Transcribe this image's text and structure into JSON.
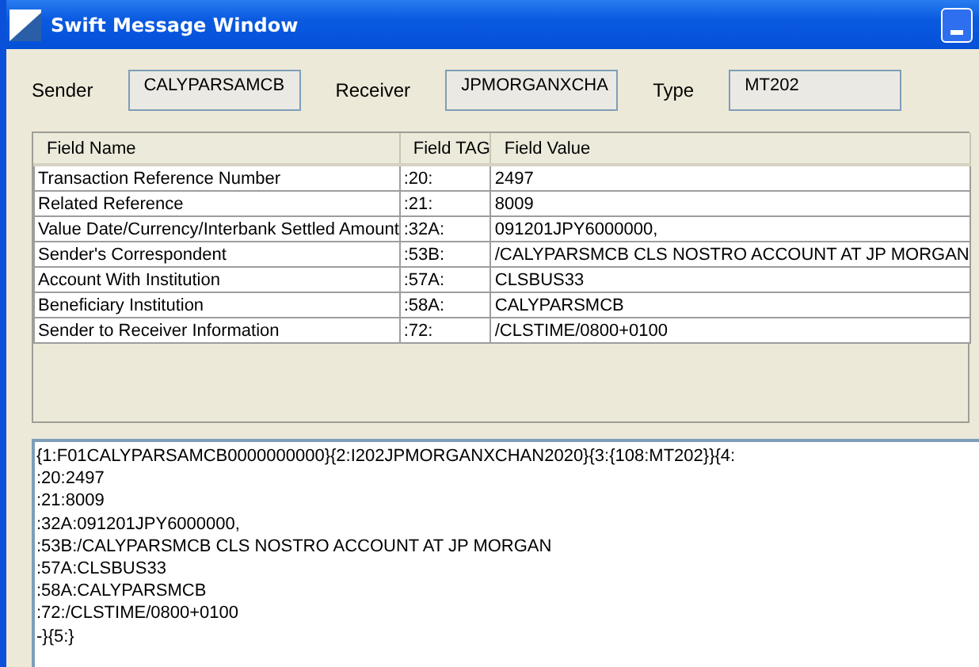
{
  "window": {
    "title": "Swift Message Window"
  },
  "header_fields": [
    {
      "label": "Sender",
      "value": "CALYPARSAMCB"
    },
    {
      "label": "Receiver",
      "value": "JPMORGANXCHA"
    },
    {
      "label": "Type",
      "value": "MT202"
    }
  ],
  "table": {
    "columns": [
      "Field Name",
      "Field TAG",
      "Field Value"
    ],
    "rows": [
      [
        "Transaction Reference Number",
        ":20:",
        "2497"
      ],
      [
        "Related Reference",
        ":21:",
        "8009"
      ],
      [
        "Value Date/Currency/Interbank Settled Amount",
        ":32A:",
        "091201JPY6000000,"
      ],
      [
        "Sender's Correspondent",
        ":53B:",
        "/CALYPARSMCB CLS NOSTRO ACCOUNT AT JP MORGAN"
      ],
      [
        "Account With Institution",
        ":57A:",
        "CLSBUS33"
      ],
      [
        "Beneficiary Institution",
        ":58A:",
        "CALYPARSMCB"
      ],
      [
        "Sender to Receiver Information",
        ":72:",
        "/CLSTIME/0800+0100"
      ]
    ]
  },
  "message_text": {
    "lines": [
      "{1:F01CALYPARSAMCB0000000000}{2:I202JPMORGANXCHAN2020}{3:{108:MT202}}{4:",
      ":20:2497",
      ":21:8009",
      ":32A:091201JPY6000000,",
      ":53B:/CALYPARSMCB CLS NOSTRO ACCOUNT AT JP MORGAN",
      ":57A:CLSBUS33",
      ":58A:CALYPARSMCB",
      ":72:/CLSTIME/0800+0100",
      "-}{5:}"
    ]
  }
}
